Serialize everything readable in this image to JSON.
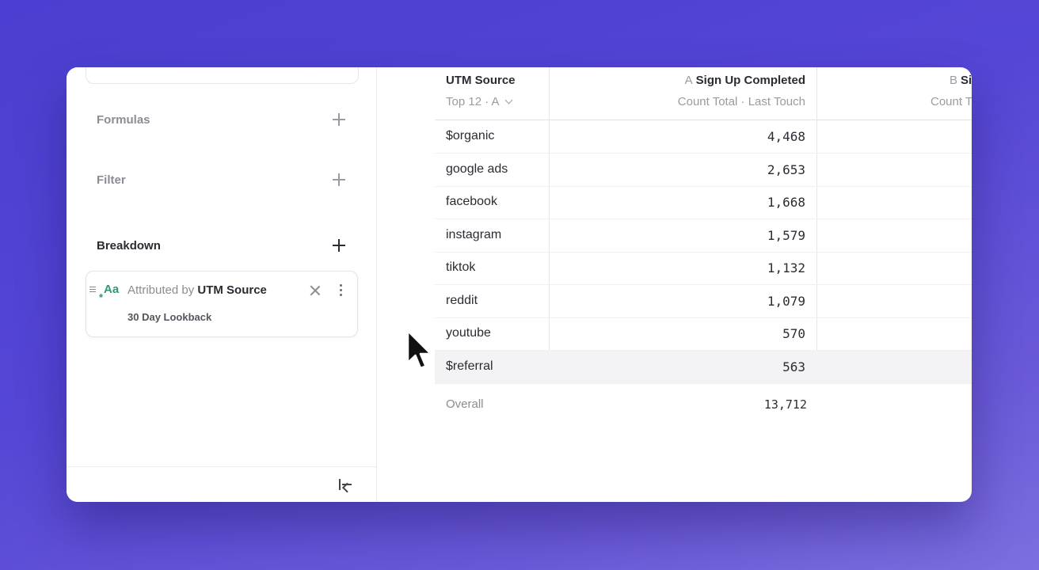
{
  "sidebar": {
    "previous_card_text": "",
    "formulas": {
      "title": "Formulas"
    },
    "filter": {
      "title": "Filter"
    },
    "breakdown": {
      "title": "Breakdown",
      "item": {
        "icon": "text-type-icon",
        "icon_text": "Aa",
        "prefix": "Attributed by",
        "property": "UTM Source",
        "subtitle": "30 Day Lookback"
      }
    },
    "footer": {
      "collapse_icon": "collapse-left-icon"
    }
  },
  "table": {
    "column_utm": {
      "title": "UTM Source",
      "subtitle": "Top 12 · A"
    },
    "column_a": {
      "letter": "A",
      "title": "Sign Up Completed",
      "subtitle": "Count Total · Last Touch"
    },
    "column_b": {
      "letter": "B",
      "title": "Si",
      "subtitle": "Count T"
    },
    "rows": [
      {
        "label": "$organic",
        "value": "4,468"
      },
      {
        "label": "google ads",
        "value": "2,653"
      },
      {
        "label": "facebook",
        "value": "1,668"
      },
      {
        "label": "instagram",
        "value": "1,579"
      },
      {
        "label": "tiktok",
        "value": "1,132"
      },
      {
        "label": "reddit",
        "value": "1,079"
      },
      {
        "label": "youtube",
        "value": "570"
      },
      {
        "label": "$referral",
        "value": "563"
      }
    ],
    "overall": {
      "label": "Overall",
      "value": "13,712"
    }
  },
  "colors": {
    "background": "#5546d6",
    "accent_icon": "#2f9a6e",
    "highlight_row": "#f3f3f5"
  }
}
